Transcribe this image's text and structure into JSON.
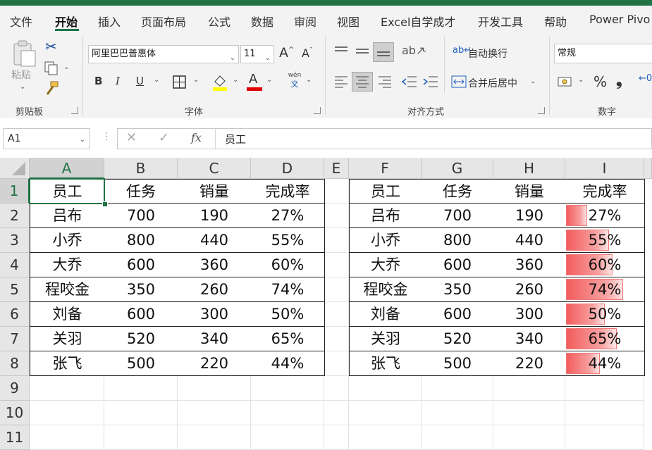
{
  "menu": {
    "tabs": [
      "文件",
      "开始",
      "插入",
      "页面布局",
      "公式",
      "数据",
      "审阅",
      "视图",
      "Excel自学成才",
      "开发工具",
      "帮助",
      "Power Pivo"
    ],
    "active_tab": "开始"
  },
  "ribbon": {
    "clipboard": {
      "paste_label": "粘贴",
      "group_label": "剪贴板"
    },
    "font": {
      "font_name": "阿里巴巴普惠体",
      "font_size": "11",
      "bold": "B",
      "italic": "I",
      "underline": "U",
      "font_color_letter": "A",
      "phonetic_top": "wén",
      "phonetic_bottom": "文",
      "grow": "A",
      "shrink": "A",
      "group_label": "字体"
    },
    "alignment": {
      "wrap_text": "自动换行",
      "merge_center": "合并后居中",
      "group_label": "对齐方式"
    },
    "number": {
      "format": "常规",
      "percent": "%",
      "comma": "❟",
      "group_label": "数字"
    }
  },
  "formula_bar": {
    "name_box": "A1",
    "fx": "fx",
    "content": "员工"
  },
  "columns": [
    "A",
    "B",
    "C",
    "D",
    "E",
    "F",
    "G",
    "H",
    "I"
  ],
  "rows": [
    "1",
    "2",
    "3",
    "4",
    "5",
    "6",
    "7",
    "8",
    "9",
    "10",
    "11"
  ],
  "table_left": {
    "headers": [
      "员工",
      "任务",
      "销量",
      "完成率"
    ],
    "rows": [
      [
        "吕布",
        "700",
        "190",
        "27%"
      ],
      [
        "小乔",
        "800",
        "440",
        "55%"
      ],
      [
        "大乔",
        "600",
        "360",
        "60%"
      ],
      [
        "程咬金",
        "350",
        "260",
        "74%"
      ],
      [
        "刘备",
        "600",
        "300",
        "50%"
      ],
      [
        "关羽",
        "520",
        "340",
        "65%"
      ],
      [
        "张飞",
        "500",
        "220",
        "44%"
      ]
    ]
  },
  "table_right": {
    "headers": [
      "员工",
      "任务",
      "销量",
      "完成率"
    ],
    "rows": [
      [
        "吕布",
        "700",
        "190",
        "27%"
      ],
      [
        "小乔",
        "800",
        "440",
        "55%"
      ],
      [
        "大乔",
        "600",
        "360",
        "60%"
      ],
      [
        "程咬金",
        "350",
        "260",
        "74%"
      ],
      [
        "刘备",
        "600",
        "300",
        "50%"
      ],
      [
        "关羽",
        "520",
        "340",
        "65%"
      ],
      [
        "张飞",
        "500",
        "220",
        "44%"
      ]
    ],
    "data_bar_values": [
      0.27,
      0.55,
      0.6,
      0.74,
      0.5,
      0.65,
      0.44
    ],
    "data_bar_color": "#f25c5c"
  },
  "colors": {
    "accent": "#217346"
  }
}
